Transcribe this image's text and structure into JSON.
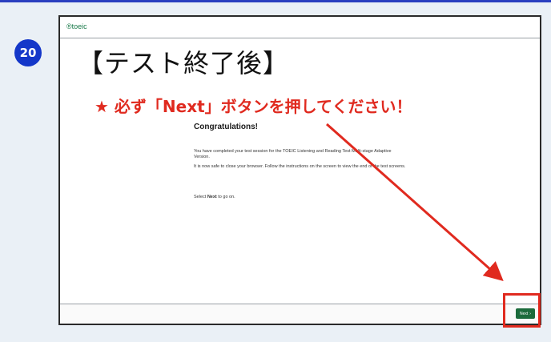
{
  "step": {
    "number": "20"
  },
  "screen": {
    "logo": "®toeic",
    "title": "【テスト終了後】",
    "notice": "★ 必ず「Next」ボタンを押してください！",
    "heading": "Congratulations!",
    "paragraphs": [
      "You have completed your test session for the TOEIC Listening and Reading Test Multi-stage Adaptive Version.",
      "It is now safe to close your browser. Follow the instructions on the screen to view the end of the test screens."
    ],
    "instruction_prefix": "Select ",
    "instruction_emphasis": "Next",
    "instruction_suffix": " to go on.",
    "next_label": "Next",
    "next_chevron": "›"
  },
  "colors": {
    "annotation": "#e02a1f",
    "badge": "#1437c9",
    "next_button": "#1c6b3c"
  }
}
